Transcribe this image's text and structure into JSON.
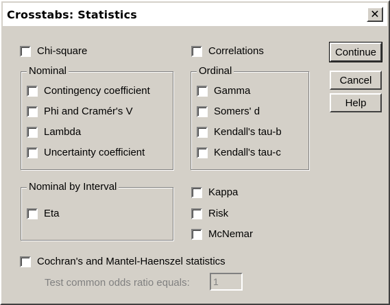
{
  "window": {
    "title": "Crosstabs: Statistics",
    "close_glyph": "✕"
  },
  "options": {
    "chi_square": {
      "label": "Chi-square",
      "checked": false
    },
    "correlations": {
      "label": "Correlations",
      "checked": false
    }
  },
  "nominal": {
    "legend": "Nominal",
    "items": [
      {
        "label": "Contingency coefficient",
        "checked": false
      },
      {
        "label": "Phi and Cramér's V",
        "checked": false
      },
      {
        "label": "Lambda",
        "checked": false
      },
      {
        "label": "Uncertainty coefficient",
        "checked": false
      }
    ]
  },
  "ordinal": {
    "legend": "Ordinal",
    "items": [
      {
        "label": "Gamma",
        "checked": false
      },
      {
        "label": "Somers' d",
        "checked": false
      },
      {
        "label": "Kendall's tau-b",
        "checked": false
      },
      {
        "label": "Kendall's tau-c",
        "checked": false
      }
    ]
  },
  "nominal_by_interval": {
    "legend": "Nominal by Interval",
    "items": [
      {
        "label": "Eta",
        "checked": false
      }
    ]
  },
  "other": {
    "items": [
      {
        "label": "Kappa",
        "checked": false
      },
      {
        "label": "Risk",
        "checked": false
      },
      {
        "label": "McNemar",
        "checked": false
      }
    ]
  },
  "cochran": {
    "label": "Cochran's and Mantel-Haenszel statistics",
    "checked": false,
    "odds_label": "Test common odds ratio equals:",
    "odds_value": "1"
  },
  "buttons": {
    "continue": "Continue",
    "cancel": "Cancel",
    "help": "Help"
  }
}
